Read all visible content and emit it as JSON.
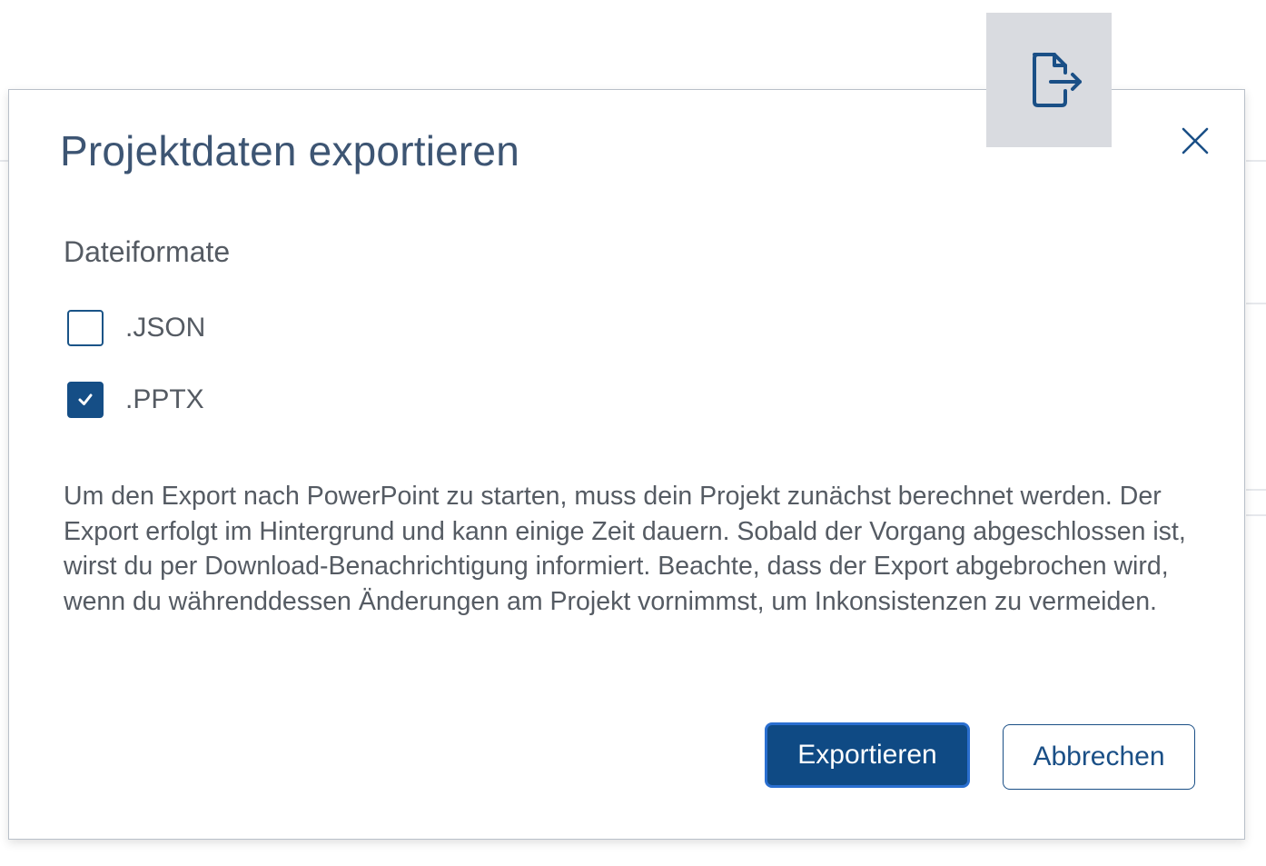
{
  "dialog": {
    "title": "Projektdaten exportieren",
    "section_label": "Dateiformate",
    "options": [
      {
        "label": ".JSON",
        "checked": false
      },
      {
        "label": ".PPTX",
        "checked": true
      }
    ],
    "info_text": "Um den Export nach PowerPoint zu starten, muss dein Projekt zunächst berechnet werden. Der Export erfolgt im Hintergrund und kann einige Zeit dauern. Sobald der Vorgang abgeschlossen ist, wirst du per Download-Benachrichtigung informiert. Beachte, dass der Export abgebrochen wird, wenn du währenddessen Änderungen am Projekt vornimmst, um Inkonsistenzen zu vermeiden.",
    "primary_button": "Exportieren",
    "secondary_button": "Abbrechen"
  },
  "icons": {
    "badge": "file-export-icon",
    "close": "close-icon",
    "checkmark": "checkmark-icon"
  },
  "colors": {
    "accent": "#154e86",
    "title": "#3d5573",
    "text": "#555b63",
    "badge_bg": "#d9dbe0"
  }
}
